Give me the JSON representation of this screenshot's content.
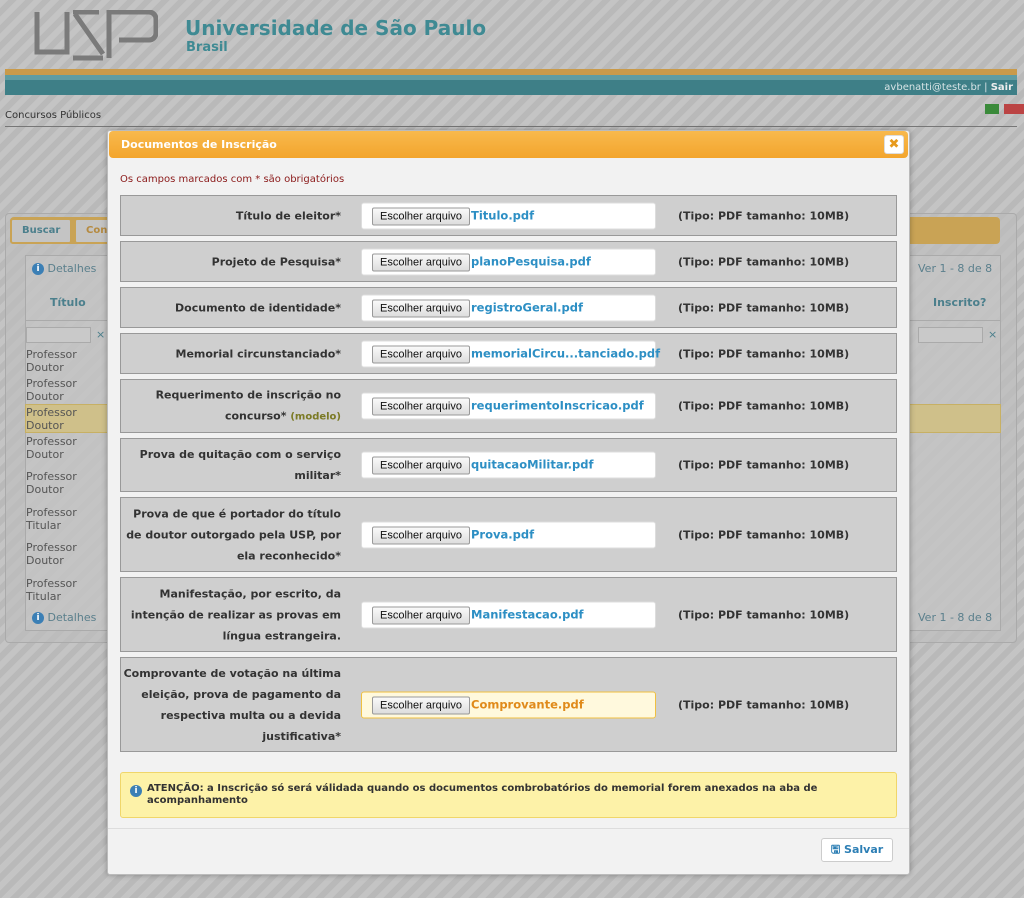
{
  "header": {
    "title": "Universidade de São Paulo",
    "subtitle": "Brasil",
    "logo_text": "USP",
    "user": "avbenatti@teste.br",
    "separator": "|",
    "logout": "Sair"
  },
  "breadcrumb": "Concursos Públicos",
  "background": {
    "tabs": [
      {
        "label": "Buscar"
      },
      {
        "label": "Con"
      }
    ],
    "details": "Detalhes",
    "pager": "Ver 1 - 8 de 8",
    "columns": [
      "Título",
      "Inscrito?"
    ],
    "filter_clear": "×",
    "rows": [
      [
        "Professor",
        "Doutor"
      ],
      [
        "Professor",
        "Doutor"
      ],
      [
        "Professor",
        "Doutor"
      ],
      [
        "Professor",
        "Doutor"
      ],
      [
        "Professor",
        "Doutor"
      ],
      [
        "Professor",
        "Titular"
      ],
      [
        "Professor",
        "Doutor"
      ],
      [
        "Professor",
        "Titular"
      ]
    ]
  },
  "modal": {
    "title": "Documentos de Inscrição",
    "close": "✖",
    "required_note": "Os campos marcados com * são obrigatórios",
    "fields": [
      {
        "label": "Título de eleitor*",
        "button": "Escolher arquivo",
        "file": "Titulo.pdf",
        "type": "(Tipo: PDF tamanho: 10MB)"
      },
      {
        "label": "Projeto de Pesquisa*",
        "button": "Escolher arquivo",
        "file": "planoPesquisa.pdf",
        "type": "(Tipo: PDF tamanho: 10MB)"
      },
      {
        "label": "Documento de identidade*",
        "button": "Escolher arquivo",
        "file": "registroGeral.pdf",
        "type": "(Tipo: PDF tamanho: 10MB)"
      },
      {
        "label": "Memorial circunstanciado*",
        "button": "Escolher arquivo",
        "file": "memorialCircu...tanciado.pdf",
        "type": "(Tipo: PDF tamanho: 10MB)"
      },
      {
        "label": "Requerimento de inscrição no concurso*",
        "link": "(modelo)",
        "button": "Escolher arquivo",
        "file": "requerimentoInscricao.pdf",
        "type": "(Tipo: PDF tamanho: 10MB)"
      },
      {
        "label": "Prova de quitação com o serviço militar*",
        "button": "Escolher arquivo",
        "file": "quitacaoMilitar.pdf",
        "type": "(Tipo: PDF tamanho: 10MB)"
      },
      {
        "label": "Prova de que é portador do título de doutor outorgado pela USP, por ela reconhecido*",
        "button": "Escolher arquivo",
        "file": "Prova.pdf",
        "type": "(Tipo: PDF tamanho: 10MB)"
      },
      {
        "label": "Manifestação, por escrito, da intenção de realizar as provas em língua estrangeira.",
        "button": "Escolher arquivo",
        "file": "Manifestacao.pdf",
        "type": "(Tipo: PDF tamanho: 10MB)"
      },
      {
        "label": "Comprovante de votação na última eleição, prova de pagamento da respectiva multa ou a devida justificativa*",
        "button": "Escolher arquivo",
        "file": "Comprovante.pdf",
        "type": "(Tipo: PDF tamanho: 10MB)"
      }
    ],
    "notice": "ATENÇÃO: a Inscrição só será válidada quando os documentos combrobatórios do memorial forem anexados na aba de acompanhamento",
    "save": "Salvar"
  },
  "colors": {
    "accent": "#f3a52d",
    "teal": "#3f8a93",
    "link": "#2d8fc4",
    "active_file": "#e08a1a"
  }
}
